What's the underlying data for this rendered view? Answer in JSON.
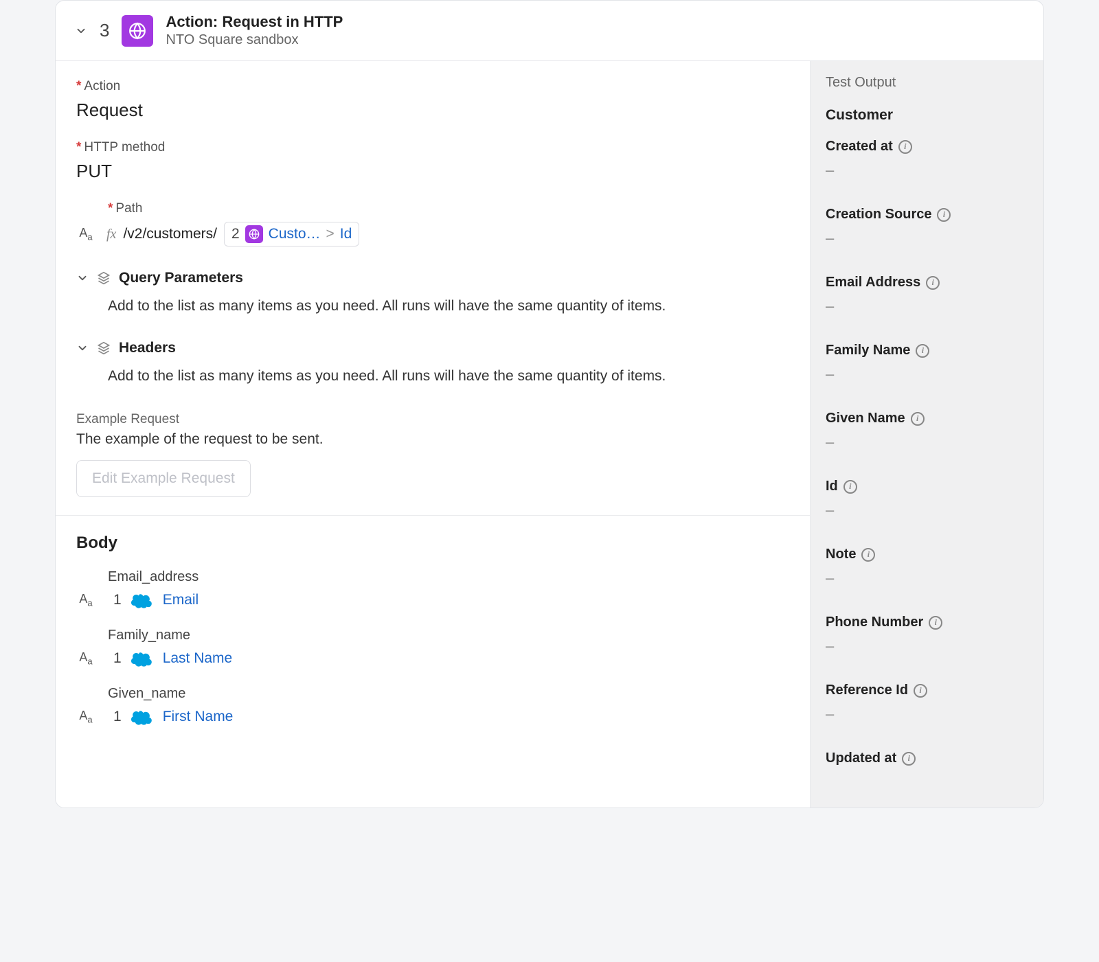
{
  "header": {
    "step_number": "3",
    "title": "Action: Request in HTTP",
    "subtitle": "NTO Square sandbox"
  },
  "action": {
    "label": "Action",
    "value": "Request",
    "method_label": "HTTP method",
    "method_value": "PUT",
    "path_label": "Path",
    "path_text": "/v2/customers/",
    "path_chip_num": "2",
    "path_chip_text": "Custo…",
    "path_chip_sep": ">",
    "path_chip_end": "Id",
    "qp_title": "Query Parameters",
    "qp_desc": "Add to the list as many items as you need. All runs will have the same quantity of items.",
    "hdr_title": "Headers",
    "hdr_desc": "Add to the list as many items as you need. All runs will have the same quantity of items.",
    "example_label": "Example Request",
    "example_desc": "The example of the request to be sent.",
    "edit_btn": "Edit Example Request"
  },
  "body": {
    "title": "Body",
    "fields": [
      {
        "label": "Email_address",
        "num": "1",
        "link": "Email"
      },
      {
        "label": "Family_name",
        "num": "1",
        "link": "Last Name"
      },
      {
        "label": "Given_name",
        "num": "1",
        "link": "First Name"
      }
    ]
  },
  "output": {
    "title": "Test Output",
    "group": "Customer",
    "items": [
      {
        "label": "Created at"
      },
      {
        "label": "Creation Source"
      },
      {
        "label": "Email Address"
      },
      {
        "label": "Family Name"
      },
      {
        "label": "Given Name"
      },
      {
        "label": "Id"
      },
      {
        "label": "Note"
      },
      {
        "label": "Phone Number"
      },
      {
        "label": "Reference Id"
      },
      {
        "label": "Updated at"
      }
    ],
    "dash": "–"
  }
}
